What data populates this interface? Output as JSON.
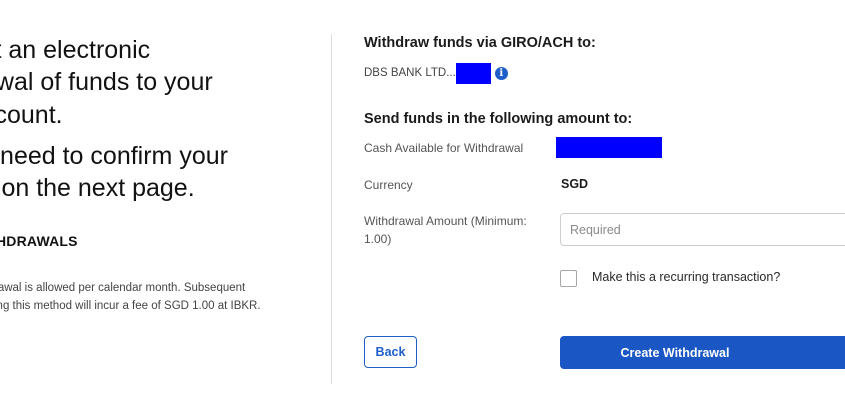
{
  "left": {
    "heading1_line1": "st an electronic",
    "heading1_line2": "awal of funds to your",
    "heading1_line3": "ccount.",
    "heading2_line1": "ll need to confirm your",
    "heading2_line2": "y on the next page.",
    "section_heading": "HDRAWALS",
    "note_line1": "rawal is allowed per calendar month. Subsequent",
    "note_line2": "ing this method will incur a fee of SGD 1.00 at IBKR."
  },
  "form": {
    "withdraw_title": "Withdraw funds via GIRO/ACH to:",
    "bank_name": "DBS BANK LTD...",
    "info_icon_glyph": "i",
    "amount_title": "Send funds in the following amount to:",
    "cash_available_label": "Cash Available for Withdrawal",
    "currency_label": "Currency",
    "currency_value": "SGD",
    "withdrawal_amount_label": "Withdrawal Amount (Minimum: 1.00)",
    "amount_placeholder": "Required",
    "recurring_label": "Make this a recurring transaction?",
    "back_label": "Back",
    "create_label": "Create Withdrawal"
  },
  "colors": {
    "accent": "#1a56c4",
    "redaction": "#0000ff",
    "divider": "#dcdcdc"
  },
  "icons": [
    "info-icon",
    "checkbox-unchecked"
  ]
}
